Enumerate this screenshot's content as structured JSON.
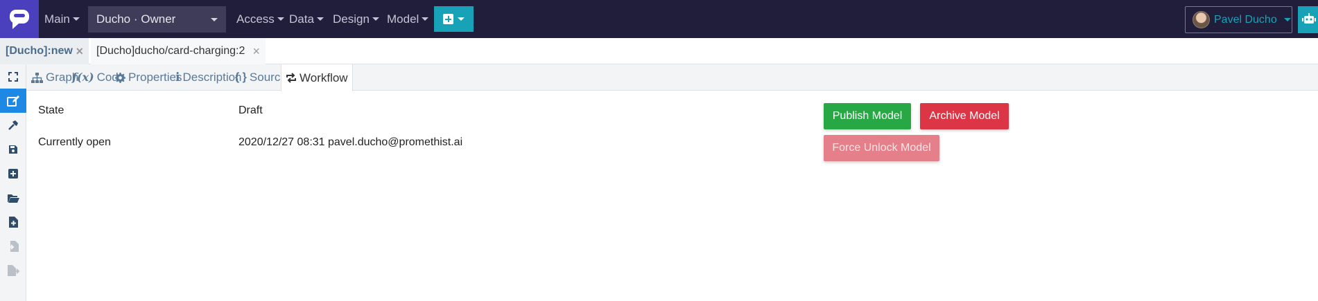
{
  "navbar": {
    "menu": [
      {
        "label": "Main"
      },
      {
        "label": "Access"
      },
      {
        "label": "Data"
      },
      {
        "label": "Design"
      },
      {
        "label": "Model"
      }
    ],
    "space_select": "Ducho · Owner",
    "user_name": "Pavel Ducho",
    "colors": {
      "navbar": "#201e3a",
      "logo": "#4a3fbd",
      "accent": "#17a2b8"
    }
  },
  "doc_tabs": [
    {
      "label": "[Ducho]:new"
    },
    {
      "label": "[Ducho]ducho/card-charging:2"
    }
  ],
  "sub_tabs": [
    {
      "label": "Graph",
      "icon": "sitemap-icon"
    },
    {
      "label": "Code",
      "icon": "function-icon"
    },
    {
      "label": "Properties",
      "icon": "gear-icon"
    },
    {
      "label": "Description",
      "icon": "info-icon"
    },
    {
      "label": "Source",
      "icon": "braces-icon"
    },
    {
      "label": "Workflow",
      "icon": "workflow-icon"
    }
  ],
  "sidebar_icons": [
    "expand-icon",
    "edit-icon",
    "hammer-icon",
    "save-icon",
    "plus-square-icon",
    "folder-open-icon",
    "file-plus-icon",
    "file-import-icon",
    "file-export-icon"
  ],
  "workflow": {
    "state_label": "State",
    "state_value": "Draft",
    "open_label": "Currently open",
    "open_value": "2020/12/27 08:31 pavel.ducho@promethist.ai"
  },
  "actions": {
    "publish": "Publish Model",
    "archive": "Archive Model",
    "force_unlock": "Force Unlock Model"
  }
}
